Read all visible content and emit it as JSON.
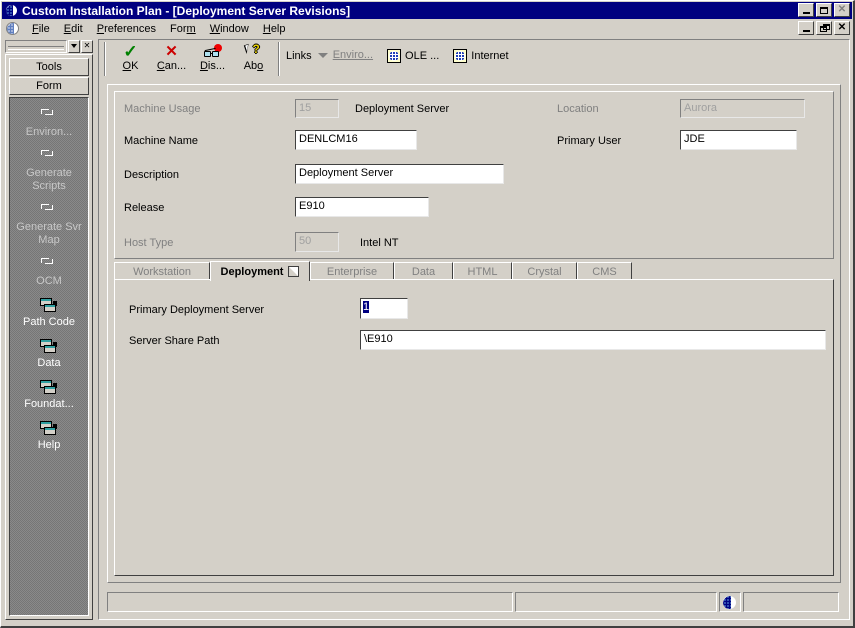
{
  "window": {
    "title": "Custom Installation Plan - [Deployment Server Revisions]",
    "icon": "globe-icon",
    "outer_buttons": [
      {
        "name": "minimize",
        "glyph": "_",
        "enabled": true
      },
      {
        "name": "maximize",
        "glyph": "☐",
        "enabled": true
      },
      {
        "name": "close",
        "glyph": "×",
        "enabled": false
      }
    ],
    "mdi_buttons": [
      {
        "name": "minimize",
        "glyph": "_",
        "enabled": true
      },
      {
        "name": "restore",
        "glyph": "❐",
        "enabled": true
      },
      {
        "name": "close",
        "glyph": "×",
        "enabled": true
      }
    ]
  },
  "menu": {
    "items": [
      {
        "label": "File",
        "mnemonic": "F"
      },
      {
        "label": "Edit",
        "mnemonic": "E"
      },
      {
        "label": "Preferences",
        "mnemonic": "P"
      },
      {
        "label": "Form",
        "mnemonic": "m"
      },
      {
        "label": "Window",
        "mnemonic": "W"
      },
      {
        "label": "Help",
        "mnemonic": "H"
      }
    ]
  },
  "toolbar": {
    "buttons": [
      {
        "label": "OK",
        "mnemonic": "O",
        "icon": "green-check-icon"
      },
      {
        "label": "Can...",
        "mnemonic": "C",
        "icon": "red-x-icon"
      },
      {
        "label": "Dis...",
        "mnemonic": "D",
        "icon": "glasses-balloon-icon"
      },
      {
        "label": "Abo",
        "mnemonic": "o",
        "icon": "arrow-question-icon"
      }
    ],
    "links_label": "Links",
    "links": [
      {
        "label": "Enviro...",
        "icon": "dropdown-triangle-icon",
        "enabled": false
      },
      {
        "label": "OLE ...",
        "icon": "ie-document-icon",
        "enabled": true
      },
      {
        "label": "Internet",
        "icon": "ie-document-icon",
        "enabled": true
      }
    ]
  },
  "left_panel": {
    "combo_value": "",
    "combo_dropdown_icon": "chevron-down-icon",
    "close_icon": "close-icon",
    "tabs": [
      {
        "label": "Tools",
        "active": false
      },
      {
        "label": "Form",
        "active": true
      }
    ],
    "items": [
      {
        "label": "Environ...",
        "icon": "corner-glyph-icon",
        "enabled": false
      },
      {
        "label": "Generate Scripts",
        "icon": "corner-glyph-icon",
        "enabled": false
      },
      {
        "label": "Generate Svr Map",
        "icon": "corner-glyph-icon",
        "enabled": false
      },
      {
        "label": "OCM",
        "icon": "corner-glyph-icon",
        "enabled": false
      },
      {
        "label": "Path Code",
        "icon": "stacked-windows-icon",
        "enabled": true
      },
      {
        "label": "Data",
        "icon": "stacked-windows-icon",
        "enabled": true
      },
      {
        "label": "Foundat...",
        "icon": "stacked-windows-icon",
        "enabled": true
      },
      {
        "label": "Help",
        "icon": "stacked-windows-icon",
        "enabled": true
      }
    ]
  },
  "form": {
    "machine_usage": {
      "label": "Machine Usage",
      "value": "15",
      "description": "Deployment Server",
      "enabled": false
    },
    "machine_name": {
      "label": "Machine Name",
      "value": "DENLCM16",
      "enabled": true
    },
    "description": {
      "label": "Description",
      "value": "Deployment Server",
      "enabled": true
    },
    "release": {
      "label": "Release",
      "value": "E910",
      "enabled": true
    },
    "host_type": {
      "label": "Host Type",
      "value": "50",
      "description": "Intel NT",
      "enabled": false
    },
    "location": {
      "label": "Location",
      "value": "Aurora",
      "enabled": false
    },
    "primary_user": {
      "label": "Primary User",
      "value": "JDE",
      "enabled": true
    }
  },
  "tabs": [
    {
      "label": "Workstation",
      "active": false
    },
    {
      "label": "Deployment",
      "active": true,
      "icon": "page-corner-icon"
    },
    {
      "label": "Enterprise",
      "active": false
    },
    {
      "label": "Data",
      "active": false
    },
    {
      "label": "HTML",
      "active": false
    },
    {
      "label": "Crystal",
      "active": false
    },
    {
      "label": "CMS",
      "active": false
    }
  ],
  "tab_panel": {
    "primary_deployment_server": {
      "label": "Primary Deployment Server",
      "value": "1",
      "selected": true
    },
    "server_share_path": {
      "label": "Server Share Path",
      "value": "\\E910"
    }
  },
  "status_bar": {
    "panes": [
      "",
      ""
    ],
    "icon": "globe-icon"
  },
  "colors": {
    "face": "#d4d0c8",
    "titlebar": "#000080",
    "selection": "#000080",
    "disabled_text": "#808080",
    "nav_background": "#808080",
    "accent_check": "#008000",
    "accent_x": "#cc0000"
  }
}
